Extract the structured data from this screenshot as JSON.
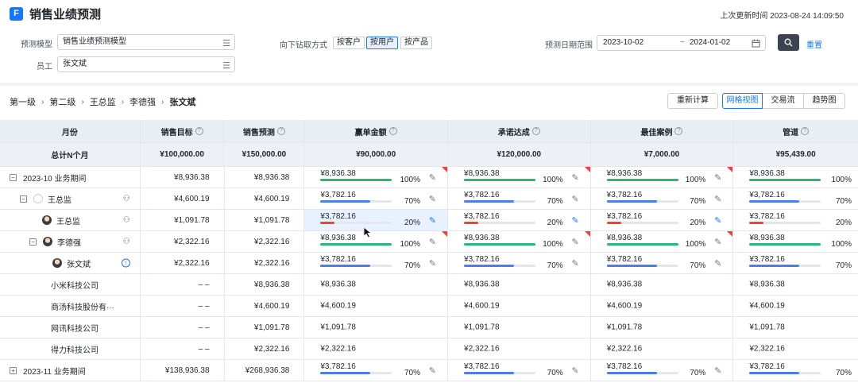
{
  "header": {
    "logo_letter": "F",
    "title": "销售业绩预测",
    "last_update_label": "上次更新时间",
    "last_update": "2023-08-24 14:09:50"
  },
  "filters": {
    "model_label": "预测模型",
    "model_value": "销售业绩预测模型",
    "employee_label": "员工",
    "employee_value": "张文斌",
    "drill_label": "向下钻取方式",
    "drill_options": [
      "按客户",
      "按用户",
      "按产品"
    ],
    "drill_selected": "按用户",
    "date_label": "预测日期范围",
    "date_start": "2023-10-02",
    "date_sep": "~",
    "date_end": "2024-01-02",
    "reset_label": "重置"
  },
  "breadcrumb": [
    "第一级",
    "第二级",
    "王总监",
    "李德强",
    "张文斌"
  ],
  "actions": {
    "recalc": "重新计算",
    "views": [
      "网格视图",
      "交易流",
      "趋势图"
    ],
    "active_view": "网格视图"
  },
  "table": {
    "columns": [
      "月份",
      "销售目标",
      "销售预测",
      "赢单金额",
      "承诺达成",
      "最佳案例",
      "管道"
    ],
    "totals": {
      "label": "总计N个月",
      "values": [
        "¥100,000.00",
        "¥150,000.00",
        "¥90,000.00",
        "¥120,000.00",
        "¥7,000.00",
        "¥95,439.00"
      ]
    },
    "rows": [
      {
        "name": "2023-10 业务期间",
        "target": "¥8,936.38",
        "forecast": "¥8,936.38",
        "metric_value": "¥8,936.38",
        "pct": "100%",
        "pipe_pct": "100%"
      },
      {
        "name": "王总监",
        "target": "¥4,600.19",
        "forecast": "¥4,600.19",
        "metric_value": "¥3,782.16",
        "pct": "70%",
        "pipe_pct": "70%"
      },
      {
        "name": "王总监",
        "target": "¥1,091.78",
        "forecast": "¥1,091.78",
        "metric_value": "¥3,782.16",
        "pct": "20%",
        "pipe_pct": "20%"
      },
      {
        "name": "李德强",
        "target": "¥2,322.16",
        "forecast": "¥2,322.16",
        "metric_value": "¥8,936.38",
        "pct": "100%",
        "pipe_pct": "100%"
      },
      {
        "name": "张文斌",
        "target": "¥2,322.16",
        "forecast": "¥2,322.16",
        "metric_value": "¥3,782.16",
        "pct": "70%",
        "pipe_pct": "70%"
      },
      {
        "name": "小米科技公司",
        "target": "– –",
        "forecast": "¥8,936.38",
        "metric_value": "¥8,936.38"
      },
      {
        "name": "商汤科技股份有···",
        "target": "– –",
        "forecast": "¥4,600.19",
        "metric_value": "¥4,600.19"
      },
      {
        "name": "网讯科技公司",
        "target": "– –",
        "forecast": "¥1,091.78",
        "metric_value": "¥1,091.78"
      },
      {
        "name": "得力科技公司",
        "target": "– –",
        "forecast": "¥2,322.16",
        "metric_value": "¥2,322.16"
      },
      {
        "name": "2023-11 业务期间",
        "target": "¥138,936.38",
        "forecast": "¥268,936.38",
        "metric_value": "¥3,782.16",
        "pct": "70%",
        "pipe_pct": "70%"
      }
    ]
  },
  "colors": {
    "green": "#2bb673",
    "blue": "#4a7ee8",
    "red": "#f53f3f",
    "accent": "#1677ff"
  }
}
